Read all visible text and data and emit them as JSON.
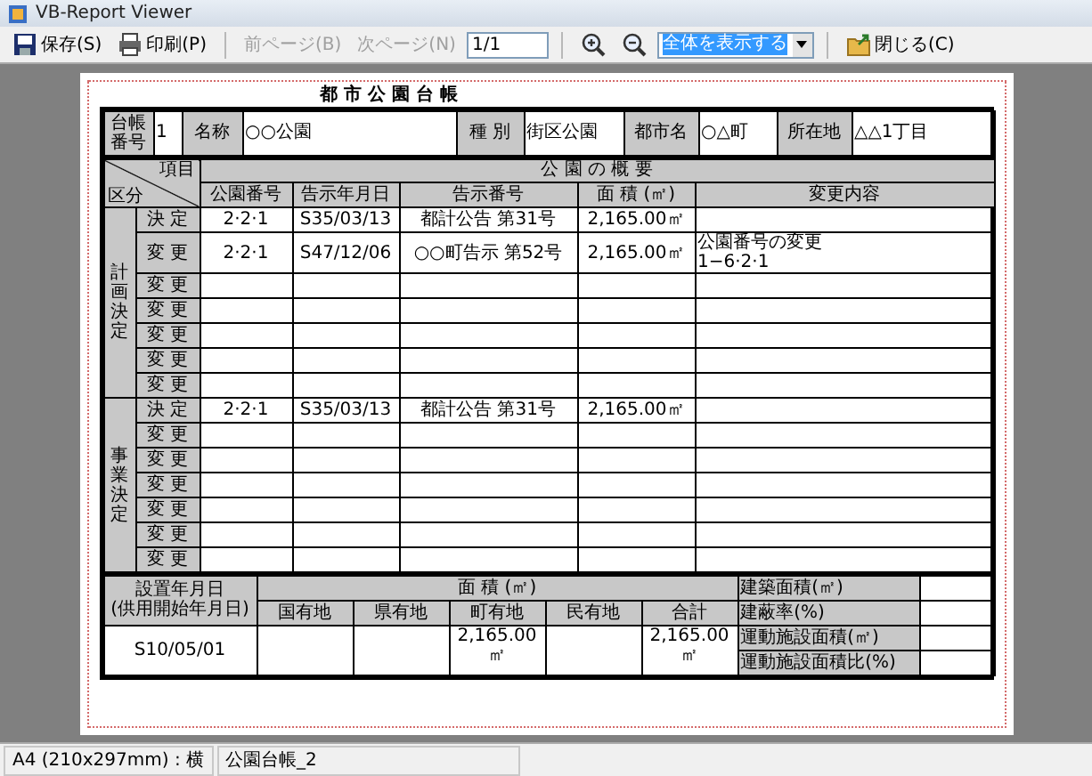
{
  "window": {
    "title": "VB-Report Viewer"
  },
  "toolbar": {
    "items": [
      {
        "kind": "save",
        "label": "保存(S)",
        "disabled": false
      },
      {
        "kind": "print",
        "label": "印刷(P)",
        "disabled": false
      },
      {
        "kind": "separator"
      },
      {
        "kind": "prev",
        "label": "前ページ(B)",
        "disabled": true
      },
      {
        "kind": "next",
        "label": "次ページ(N)",
        "disabled": true
      },
      {
        "kind": "page",
        "value": "1/1"
      },
      {
        "kind": "separator"
      },
      {
        "kind": "zoom_in"
      },
      {
        "kind": "zoom_out"
      },
      {
        "kind": "zoom",
        "value": "全体を表示する"
      },
      {
        "kind": "separator"
      },
      {
        "kind": "close",
        "label": "閉じる(C)",
        "disabled": false
      }
    ]
  },
  "report": {
    "title": "都 市 公 園 台 帳",
    "header": [
      {
        "kind": "label",
        "text": "台帳番号"
      },
      {
        "kind": "value",
        "text": "1"
      },
      {
        "kind": "label",
        "text": "名称"
      },
      {
        "kind": "value",
        "text": "○○公園"
      },
      {
        "kind": "label",
        "text": "種 別"
      },
      {
        "kind": "value",
        "text": "街区公園"
      },
      {
        "kind": "label",
        "text": "都市名"
      },
      {
        "kind": "value",
        "text": "○△町"
      },
      {
        "kind": "label",
        "text": "所在地"
      },
      {
        "kind": "value",
        "text": "△△1丁目"
      }
    ],
    "corner_top": "項目",
    "corner_bottom": "区分",
    "overview_title": "公 園 の 概 要",
    "columns": [
      "公園番号",
      "告示年月日",
      "告示番号",
      "面 積 (㎡)",
      "変更内容"
    ],
    "groups": [
      {
        "name": "計画決定",
        "rows": [
          {
            "label": "決 定",
            "park_no": "2·2·1",
            "date": "S35/03/13",
            "notice": "都計公告 第31号",
            "area": "2,165.00㎡"
          },
          {
            "label": "変 更",
            "park_no": "2·2·1",
            "date": "S47/12/06",
            "notice": "○○町告示 第52号",
            "area": "2,165.00㎡",
            "change": [
              "公園番号の変更",
              "1−6·2·1"
            ]
          },
          {
            "label": "変 更"
          },
          {
            "label": "変 更"
          },
          {
            "label": "変 更"
          },
          {
            "label": "変 更"
          },
          {
            "label": "変 更"
          }
        ]
      },
      {
        "name": "事業決定",
        "rows": [
          {
            "label": "決 定",
            "park_no": "2·2·1",
            "date": "S35/03/13",
            "notice": "都計公告 第31号",
            "area": "2,165.00㎡"
          },
          {
            "label": "変 更"
          },
          {
            "label": "変 更"
          },
          {
            "label": "変 更"
          },
          {
            "label": "変 更"
          },
          {
            "label": "変 更"
          },
          {
            "label": "変 更"
          }
        ]
      }
    ],
    "established_label": [
      "設置年月日",
      "(供用開始年月日)"
    ],
    "established": "S10/05/01",
    "area_title": "面 積 (㎡)",
    "area_columns": [
      {
        "name": "国有地"
      },
      {
        "name": "県有地"
      },
      {
        "name": "町有地",
        "value": "2,165.00㎡"
      },
      {
        "name": "民有地"
      },
      {
        "name": "合計",
        "value": "2,165.00㎡"
      }
    ],
    "facilities": [
      "建築面積(㎡)",
      "建蔽率(%)",
      "運動施設面積(㎡)",
      "運動施設面積比(%)"
    ]
  },
  "status_bar": [
    "A4 (210x297mm) : 横",
    "公園台帳_2"
  ]
}
